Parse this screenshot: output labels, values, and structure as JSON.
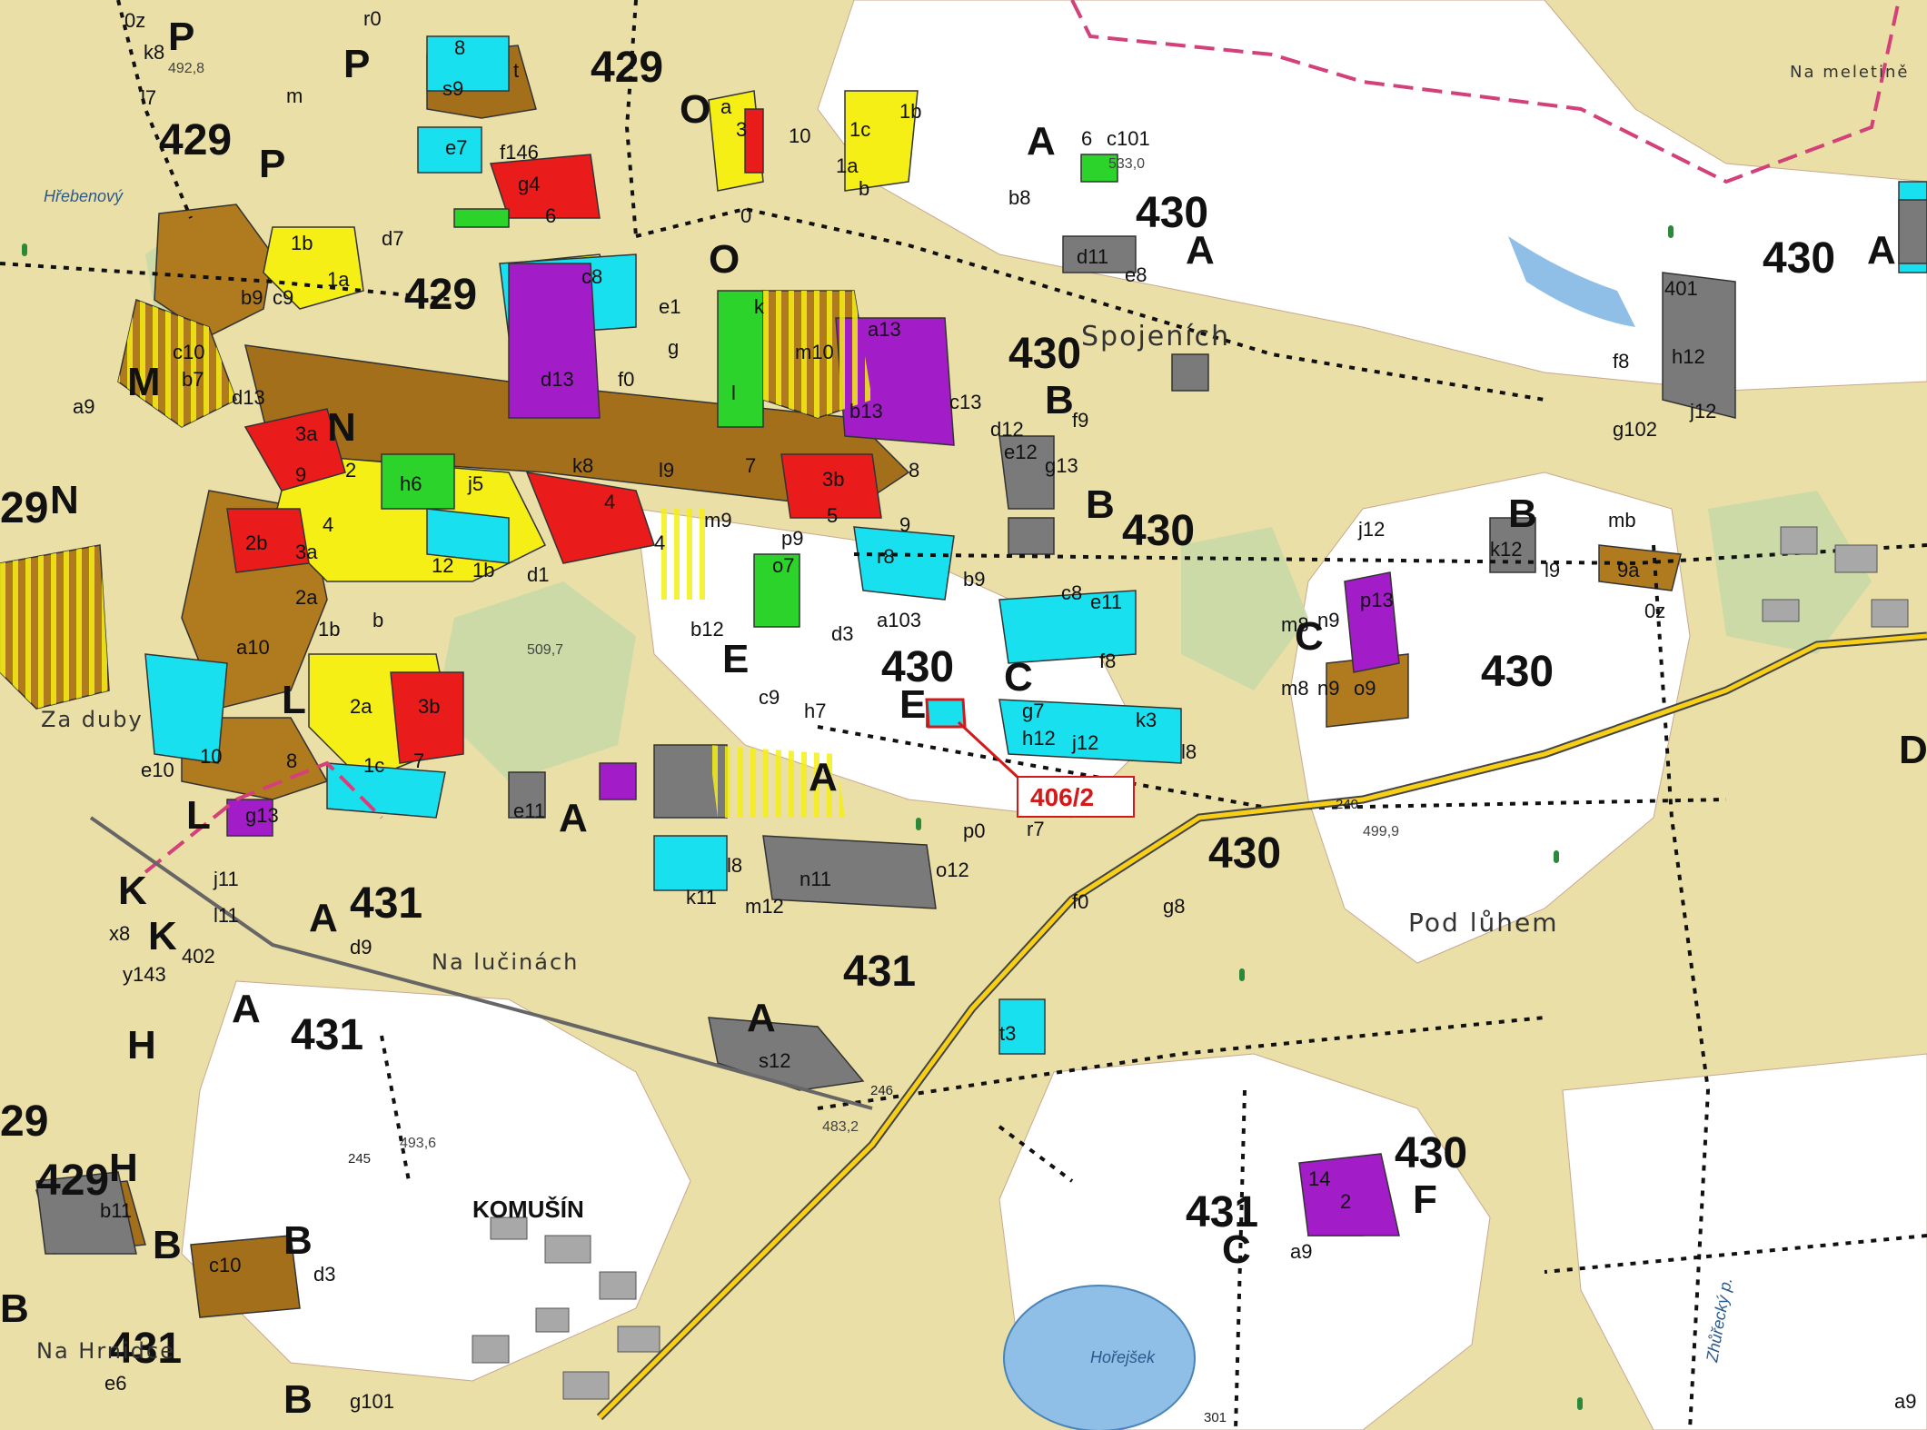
{
  "map": {
    "compartments": [
      "429",
      "429",
      "429",
      "430",
      "430",
      "430",
      "430",
      "430",
      "430",
      "430",
      "430",
      "431",
      "431",
      "431",
      "431",
      "431",
      "29",
      "29",
      "429"
    ],
    "stand_letters": [
      "P",
      "P",
      "P",
      "O",
      "O",
      "A",
      "A",
      "A",
      "M",
      "N",
      "N",
      "B",
      "B",
      "B",
      "C",
      "C",
      "E",
      "E",
      "L",
      "L",
      "K",
      "K",
      "A",
      "A",
      "A",
      "A",
      "A",
      "H",
      "H",
      "F",
      "C",
      "B",
      "B",
      "B",
      "B",
      "D"
    ],
    "plot_labels": [
      "0z",
      "k8",
      "l7",
      "m",
      "r0",
      "8",
      "s9",
      "t",
      "a",
      "3",
      "10",
      "1c",
      "1b",
      "1a",
      "b",
      "0",
      "6",
      "c101",
      "b8",
      "d11",
      "e8",
      "h12",
      "j12",
      "401",
      "f8",
      "g102",
      "e7",
      "f146",
      "g4",
      "6",
      "d7",
      "c8",
      "e1",
      "k",
      "1b",
      "1a",
      "b9",
      "c9",
      "c10",
      "b7",
      "d13",
      "a9",
      "d13",
      "f0",
      "g",
      "l",
      "m10",
      "a13",
      "b13",
      "c13",
      "d12",
      "e12",
      "f9",
      "g13",
      "3a",
      "9",
      "2",
      "h6",
      "j5",
      "k8",
      "l9",
      "7",
      "3b",
      "8",
      "4",
      "4",
      "m9",
      "p9",
      "5",
      "9",
      "r8",
      "b9",
      "c8",
      "e11",
      "a103",
      "d3",
      "b12",
      "c9",
      "h7",
      "f8",
      "g7",
      "h12",
      "j12",
      "k3",
      "l8",
      "m8",
      "n9",
      "o9",
      "p13",
      "2b",
      "3a",
      "4",
      "12",
      "1b",
      "d1",
      "2a",
      "1b",
      "b",
      "a10",
      "2a",
      "3b",
      "1c",
      "7",
      "10",
      "8",
      "e10",
      "g13",
      "e11",
      "j11",
      "l11",
      "x8",
      "y143",
      "402",
      "d9",
      "k11",
      "l8",
      "m12",
      "n11",
      "o12",
      "p0",
      "r7",
      "f0",
      "g8",
      "s12",
      "t3",
      "b11",
      "c10",
      "d3",
      "a9",
      "14",
      "2",
      "e6",
      "g101",
      "a9",
      "o7",
      "n9",
      "m8",
      "mb",
      "9a",
      "l9",
      "k12",
      "j12",
      "0z"
    ],
    "place_names": [
      "Na meletině",
      "Hřebenový",
      "Spojeních",
      "Za duby",
      "Na lučinách",
      "Pod lůhem",
      "KOMUŠÍN",
      "Hořejšek",
      "Na Hrnidce",
      "Zhůřecký p."
    ],
    "elevations": [
      "492,8",
      "533,0",
      "509,7",
      "499,9",
      "493,6",
      "483,2"
    ],
    "road_markers": [
      "240",
      "246",
      "245",
      "301"
    ],
    "callout": {
      "label": "406/2"
    }
  }
}
